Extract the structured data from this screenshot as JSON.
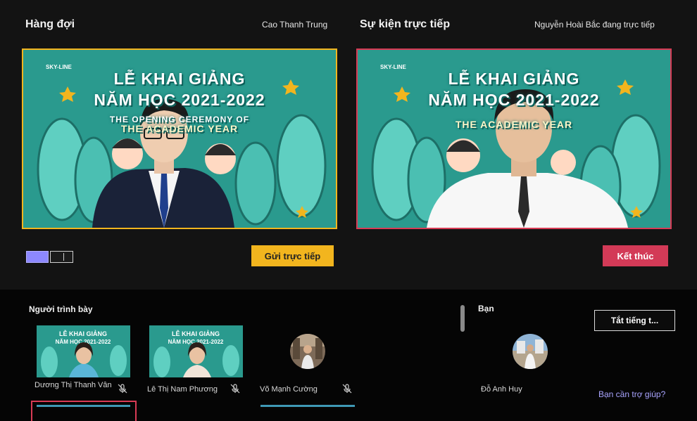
{
  "queue": {
    "title": "Hàng đợi",
    "presenter_name": "Cao Thanh Trung",
    "send_live_label": "Gửi trực tiếp"
  },
  "live": {
    "title": "Sự kiện trực tiếp",
    "status_text": "Nguyễn Hoài Bắc đang trực tiếp",
    "end_label": "Kết thúc"
  },
  "banner": {
    "logo": "SKY-LINE",
    "line1": "LỄ KHAI GIẢNG",
    "line2": "NĂM HỌC 2021-2022",
    "line3": "THE OPENING CEREMONY OF",
    "line4": "THE ACADEMIC YEAR"
  },
  "presenters": {
    "title": "Người trình bày",
    "people": [
      {
        "name": "Dương Thị Thanh Vân"
      },
      {
        "name": "Lê Thị Nam Phương"
      },
      {
        "name": "Võ Mạnh Cường"
      }
    ]
  },
  "you": {
    "title": "Bạn",
    "name": "Đỗ Anh Huy",
    "mute_all_label": "Tắt tiếng t...",
    "help_label": "Bạn cần trợ giúp?"
  },
  "colors": {
    "accent_yellow": "#f2b51e",
    "accent_red": "#d33a57",
    "accent_purple": "#8d88ff",
    "banner_teal": "#2a9a8e"
  },
  "icons": {
    "layout_a": "single-layout-icon",
    "layout_b": "side-layout-icon",
    "mic": "mic-off-icon"
  }
}
